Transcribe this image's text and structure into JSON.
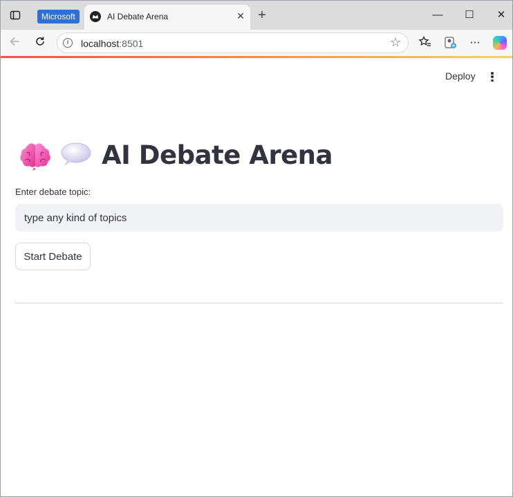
{
  "browser": {
    "badge": "Microsoft",
    "tab_title": "AI Debate Arena",
    "tab_close": "✕",
    "new_tab": "+",
    "url_host": "localhost",
    "url_port": ":8501",
    "window_controls": {
      "minimize": "—",
      "maximize": "☐",
      "close": "✕"
    },
    "icons": {
      "back": "back-arrow-icon",
      "reload": "reload-icon",
      "site_info": "info-icon",
      "favorite": "star-icon",
      "favorites_bar": "favorites-icon",
      "profile": "profile-icon",
      "more": "more-icon",
      "copilot": "copilot-icon"
    }
  },
  "app": {
    "deploy_label": "Deploy",
    "title": "AI Debate Arena",
    "title_emojis": [
      "brain-emoji",
      "speech-balloon-emoji"
    ],
    "topic_label": "Enter debate topic:",
    "topic_value": "type any kind of topics",
    "start_button": "Start Debate"
  },
  "colors": {
    "accent_line_start": "#ff4b4b",
    "text": "#31333f",
    "input_bg": "#f0f2f6",
    "ms_badge": "#2f6fd6"
  }
}
